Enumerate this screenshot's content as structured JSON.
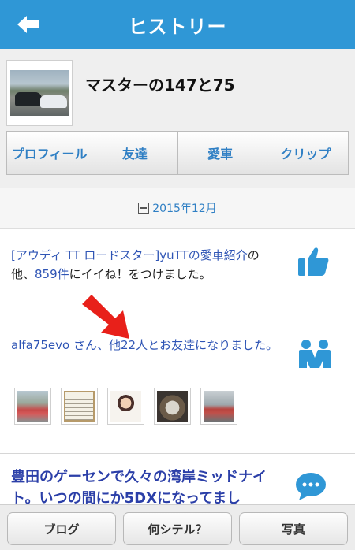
{
  "header": {
    "title": "ヒストリー",
    "back_icon": "back-arrow-icon"
  },
  "profile": {
    "name": "マスターの147と75",
    "tabs": [
      {
        "label": "プロフィール"
      },
      {
        "label": "友達"
      },
      {
        "label": "愛車"
      },
      {
        "label": "クリップ"
      }
    ]
  },
  "month": {
    "label": "2015年12月",
    "icon": "collapse-minus-icon"
  },
  "feed": [
    {
      "type": "like",
      "icon": "thumbs-up-icon",
      "link": "[アウディ TT ロードスター]yuTTの愛車紹介",
      "text_mid": "の他、",
      "count": "859件",
      "text_end": "にイイね！をつけました。"
    },
    {
      "type": "friends",
      "icon": "friends-icon",
      "link_user": "alfa75evo",
      "text_mid": " さん、他",
      "count": "22人",
      "text_end": "とお友達になりました。"
    },
    {
      "type": "article",
      "icon": "speech-bubble-icon",
      "title": "豊田のゲーセンで久々の湾岸ミッドナイト。いつの間にか5DXになってまし"
    }
  ],
  "bottom_nav": [
    {
      "label": "ブログ"
    },
    {
      "label": "何シテル？"
    },
    {
      "label": "写真"
    }
  ],
  "colors": {
    "accent": "#2f97d6",
    "link": "#2f55b5",
    "title": "#2b3fa8",
    "arrow": "#e8201a"
  }
}
